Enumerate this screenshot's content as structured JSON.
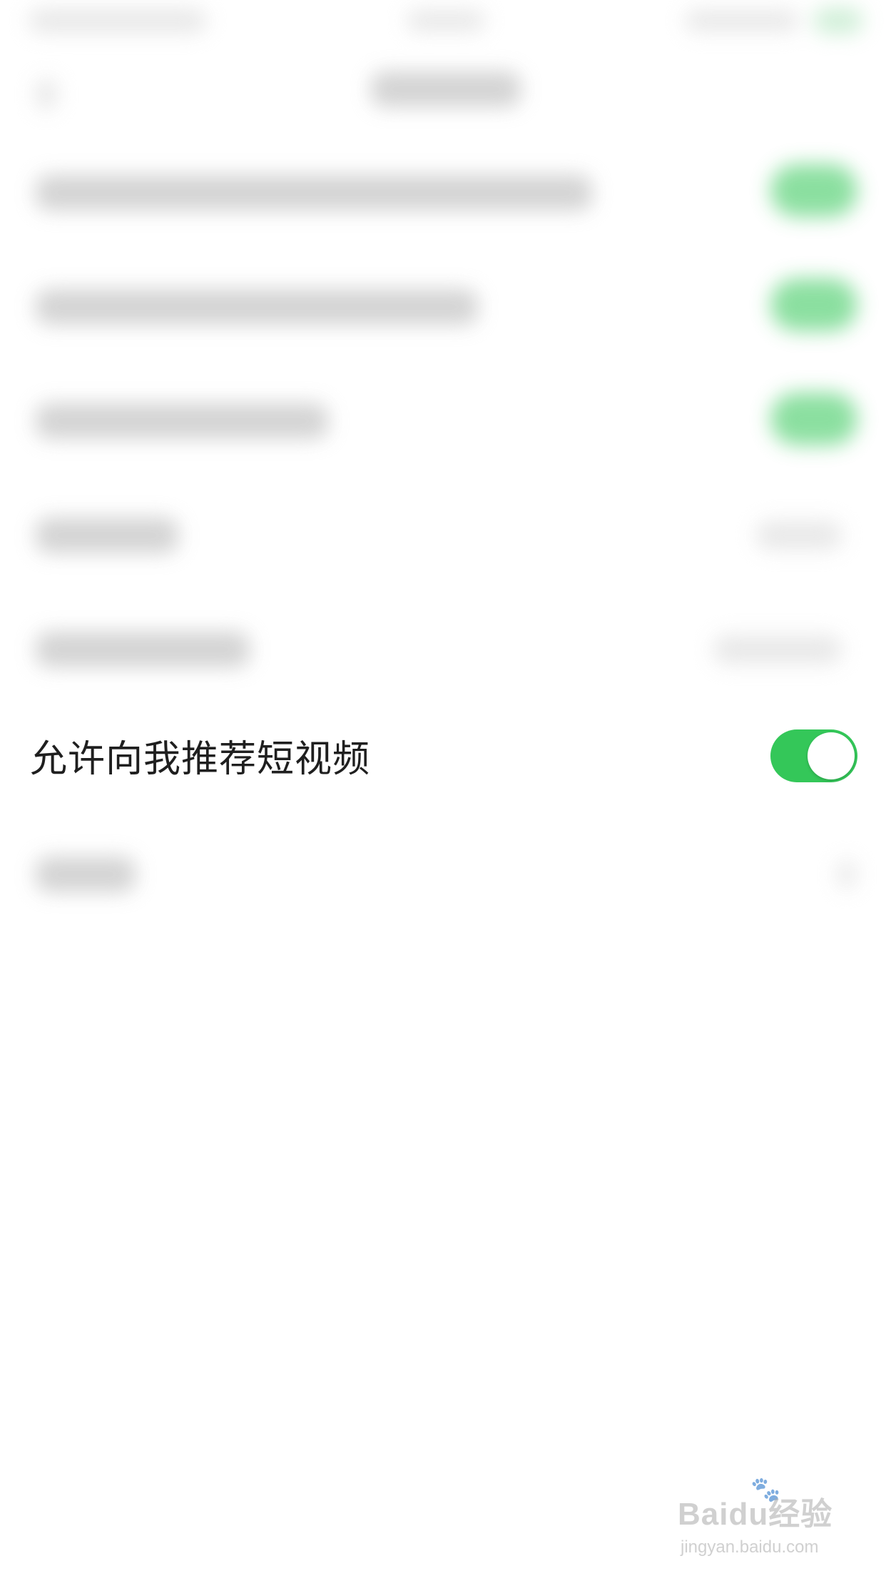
{
  "settings": {
    "recommend_short_video": {
      "label": "允许向我推荐短视频",
      "enabled": true
    }
  },
  "colors": {
    "toggle_on": "#34c759",
    "background": "#ffffff",
    "text": "#1f1f1f"
  },
  "watermark": {
    "brand": "Baidu经验",
    "url": "jingyan.baidu.com",
    "icon": "paw-icon"
  }
}
